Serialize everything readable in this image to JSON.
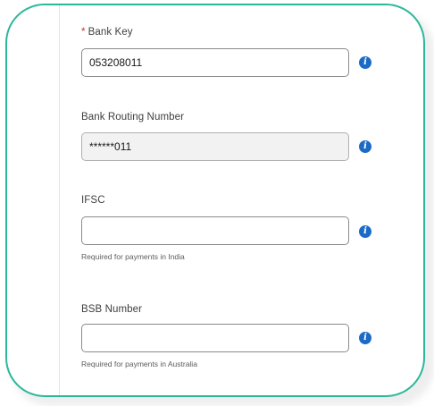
{
  "form": {
    "bank_key": {
      "required_marker": "*",
      "label": "Bank Key",
      "value": "053208011"
    },
    "bank_routing_number": {
      "label": "Bank Routing Number",
      "value": "******011"
    },
    "ifsc": {
      "label": "IFSC",
      "value": "",
      "help": "Required for payments in India"
    },
    "bsb_number": {
      "label": "BSB Number",
      "value": "",
      "help": "Required for payments in Australia"
    },
    "info_icon_glyph": "i"
  },
  "colors": {
    "card_border": "#2bb89a",
    "info_icon": "#1b6bc6",
    "required": "#c23934"
  }
}
